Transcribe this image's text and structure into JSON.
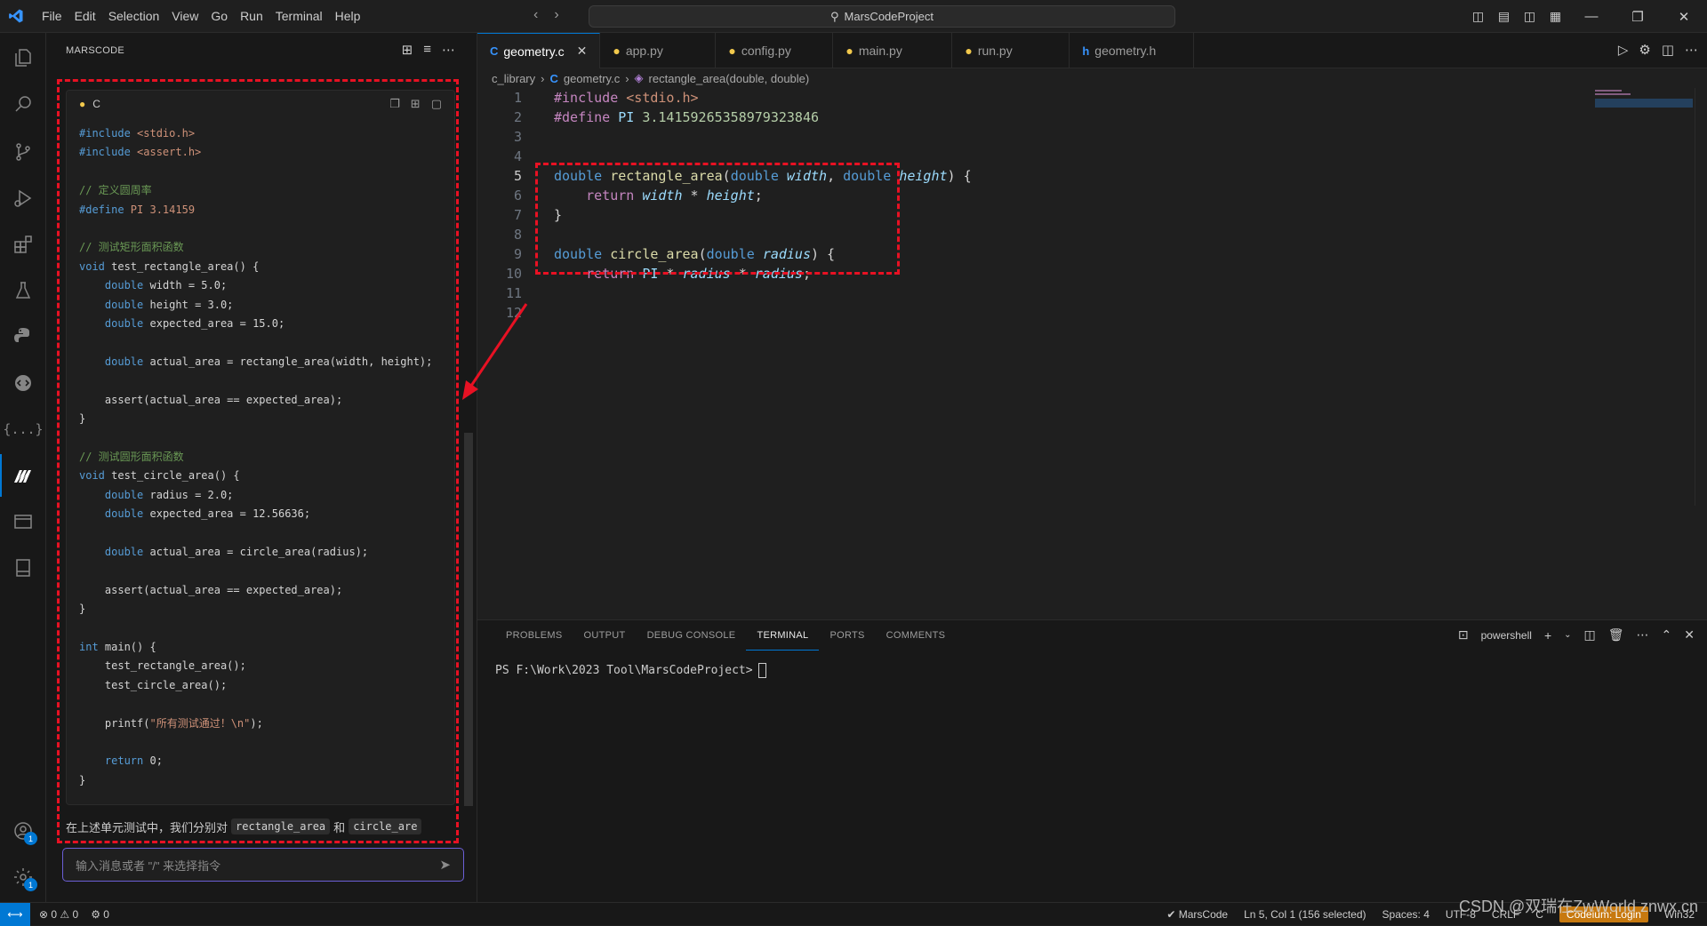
{
  "titlebar": {
    "menus": [
      "File",
      "Edit",
      "Selection",
      "View",
      "Go",
      "Run",
      "Terminal",
      "Help"
    ],
    "search_text": "MarsCodeProject"
  },
  "sidebar": {
    "title": "MARSCODE",
    "code_block": {
      "language": "C",
      "lines": [
        "#include <stdio.h>",
        "#include <assert.h>",
        "",
        "// 定义圆周率",
        "#define PI 3.14159",
        "",
        "// 测试矩形面积函数",
        "void test_rectangle_area() {",
        "    double width = 5.0;",
        "    double height = 3.0;",
        "    double expected_area = 15.0;",
        "",
        "    double actual_area = rectangle_area(width, height);",
        "",
        "    assert(actual_area == expected_area);",
        "}",
        "",
        "// 测试圆形面积函数",
        "void test_circle_area() {",
        "    double radius = 2.0;",
        "    double expected_area = 12.56636;",
        "",
        "    double actual_area = circle_area(radius);",
        "",
        "    assert(actual_area == expected_area);",
        "}",
        "",
        "int main() {",
        "    test_rectangle_area();",
        "    test_circle_area();",
        "",
        "    printf(\"所有测试通过！\\n\");",
        "",
        "    return 0;",
        "}"
      ]
    },
    "summary_prefix": "在上述单元测试中，我们分别对",
    "summary_code1": "rectangle_area",
    "summary_mid": "和",
    "summary_code2": "circle_are",
    "input_placeholder": "输入消息或者 \"/\" 来选择指令"
  },
  "editor": {
    "tabs": [
      {
        "label": "geometry.c",
        "icon": "C",
        "icon_color": "#3794ff",
        "active": true
      },
      {
        "label": "app.py",
        "icon": "py",
        "icon_color": "#f2c94c",
        "active": false
      },
      {
        "label": "config.py",
        "icon": "py",
        "icon_color": "#f2c94c",
        "active": false
      },
      {
        "label": "main.py",
        "icon": "py",
        "icon_color": "#f2c94c",
        "active": false
      },
      {
        "label": "run.py",
        "icon": "py",
        "icon_color": "#f2c94c",
        "active": false
      },
      {
        "label": "geometry.h",
        "icon": "h",
        "icon_color": "#3794ff",
        "active": false
      }
    ],
    "breadcrumb": [
      "c_library",
      "geometry.c",
      "rectangle_area(double, double)"
    ],
    "line_numbers": [
      "1",
      "2",
      "3",
      "4",
      "5",
      "6",
      "7",
      "8",
      "9",
      "10",
      "11",
      "12"
    ],
    "current_line": 5
  },
  "panel": {
    "tabs": [
      "PROBLEMS",
      "OUTPUT",
      "DEBUG CONSOLE",
      "TERMINAL",
      "PORTS",
      "COMMENTS"
    ],
    "active_tab": "TERMINAL",
    "shell": "powershell",
    "prompt": "PS F:\\Work\\2023 Tool\\MarsCodeProject>"
  },
  "statusbar": {
    "errors": "0",
    "warnings": "0",
    "ports": "0",
    "marscode": "MarsCode",
    "position": "Ln 5, Col 1 (156 selected)",
    "spaces": "Spaces: 4",
    "encoding": "UTF-8",
    "eol": "CRLF",
    "language": "C",
    "codeium": "Codeium: Login",
    "platform": "Win32"
  },
  "watermark": "CSDN @双瑞在ZwWorld znwx.cn",
  "colors": {
    "accent": "#0078d4",
    "highlight_box": "#e81123"
  }
}
